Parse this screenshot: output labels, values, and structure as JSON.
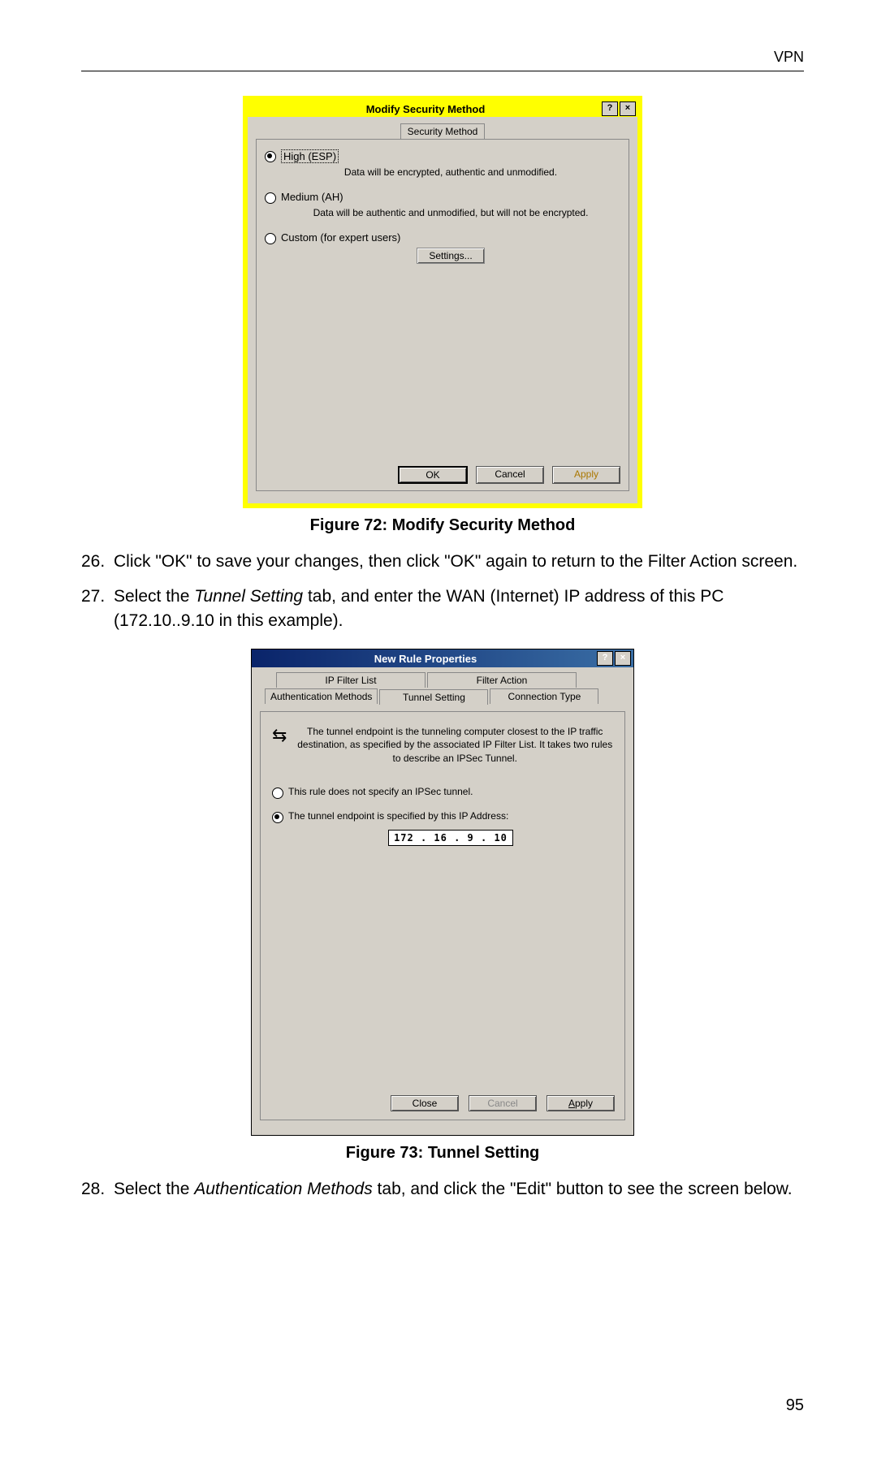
{
  "header": {
    "section": "VPN"
  },
  "dialog1": {
    "title": "Modify Security Method",
    "help_btn": "?",
    "close_btn": "×",
    "tab": "Security Method",
    "opt1_label": "High (ESP)",
    "opt1_desc": "Data will be encrypted, authentic and unmodified.",
    "opt2_label": "Medium (AH)",
    "opt2_desc": "Data will be authentic and unmodified, but will not be encrypted.",
    "opt3_label": "Custom (for expert users)",
    "settings_btn": "Settings...",
    "ok": "OK",
    "cancel": "Cancel",
    "apply": "Apply"
  },
  "caption1": "Figure 72: Modify Security Method",
  "step26_num": "26.",
  "step26_txt": "Click \"OK\" to save your changes, then click \"OK\" again to return to the Filter Action screen.",
  "step27_num": "27.",
  "step27_pre": "Select the ",
  "step27_em": "Tunnel Setting",
  "step27_post": " tab, and enter the WAN (Internet) IP address of this PC (172.10..9.10 in this example).",
  "dialog2": {
    "title": "New Rule Properties",
    "help_btn": "?",
    "close_btn": "×",
    "tab_back1": "IP Filter List",
    "tab_back2": "Filter Action",
    "tab_front1": "Authentication Methods",
    "tab_front2": "Tunnel Setting",
    "tab_front3": "Connection Type",
    "info_text": "The tunnel endpoint is the tunneling computer closest to the IP traffic destination, as specified by the associated IP Filter List. It takes two rules to describe an IPSec Tunnel.",
    "opt1": "This rule does not specify an IPSec tunnel.",
    "opt2": "The tunnel endpoint is specified by this IP Address:",
    "ip": "172 . 16  .  9   . 10",
    "close_btn2": "Close",
    "cancel": "Cancel",
    "apply": "Apply"
  },
  "caption2": "Figure 73: Tunnel Setting",
  "step28_num": "28.",
  "step28_pre": "Select the ",
  "step28_em": "Authentication Methods",
  "step28_post": " tab, and click the \"Edit\" button to see the screen below.",
  "page_number": "95"
}
